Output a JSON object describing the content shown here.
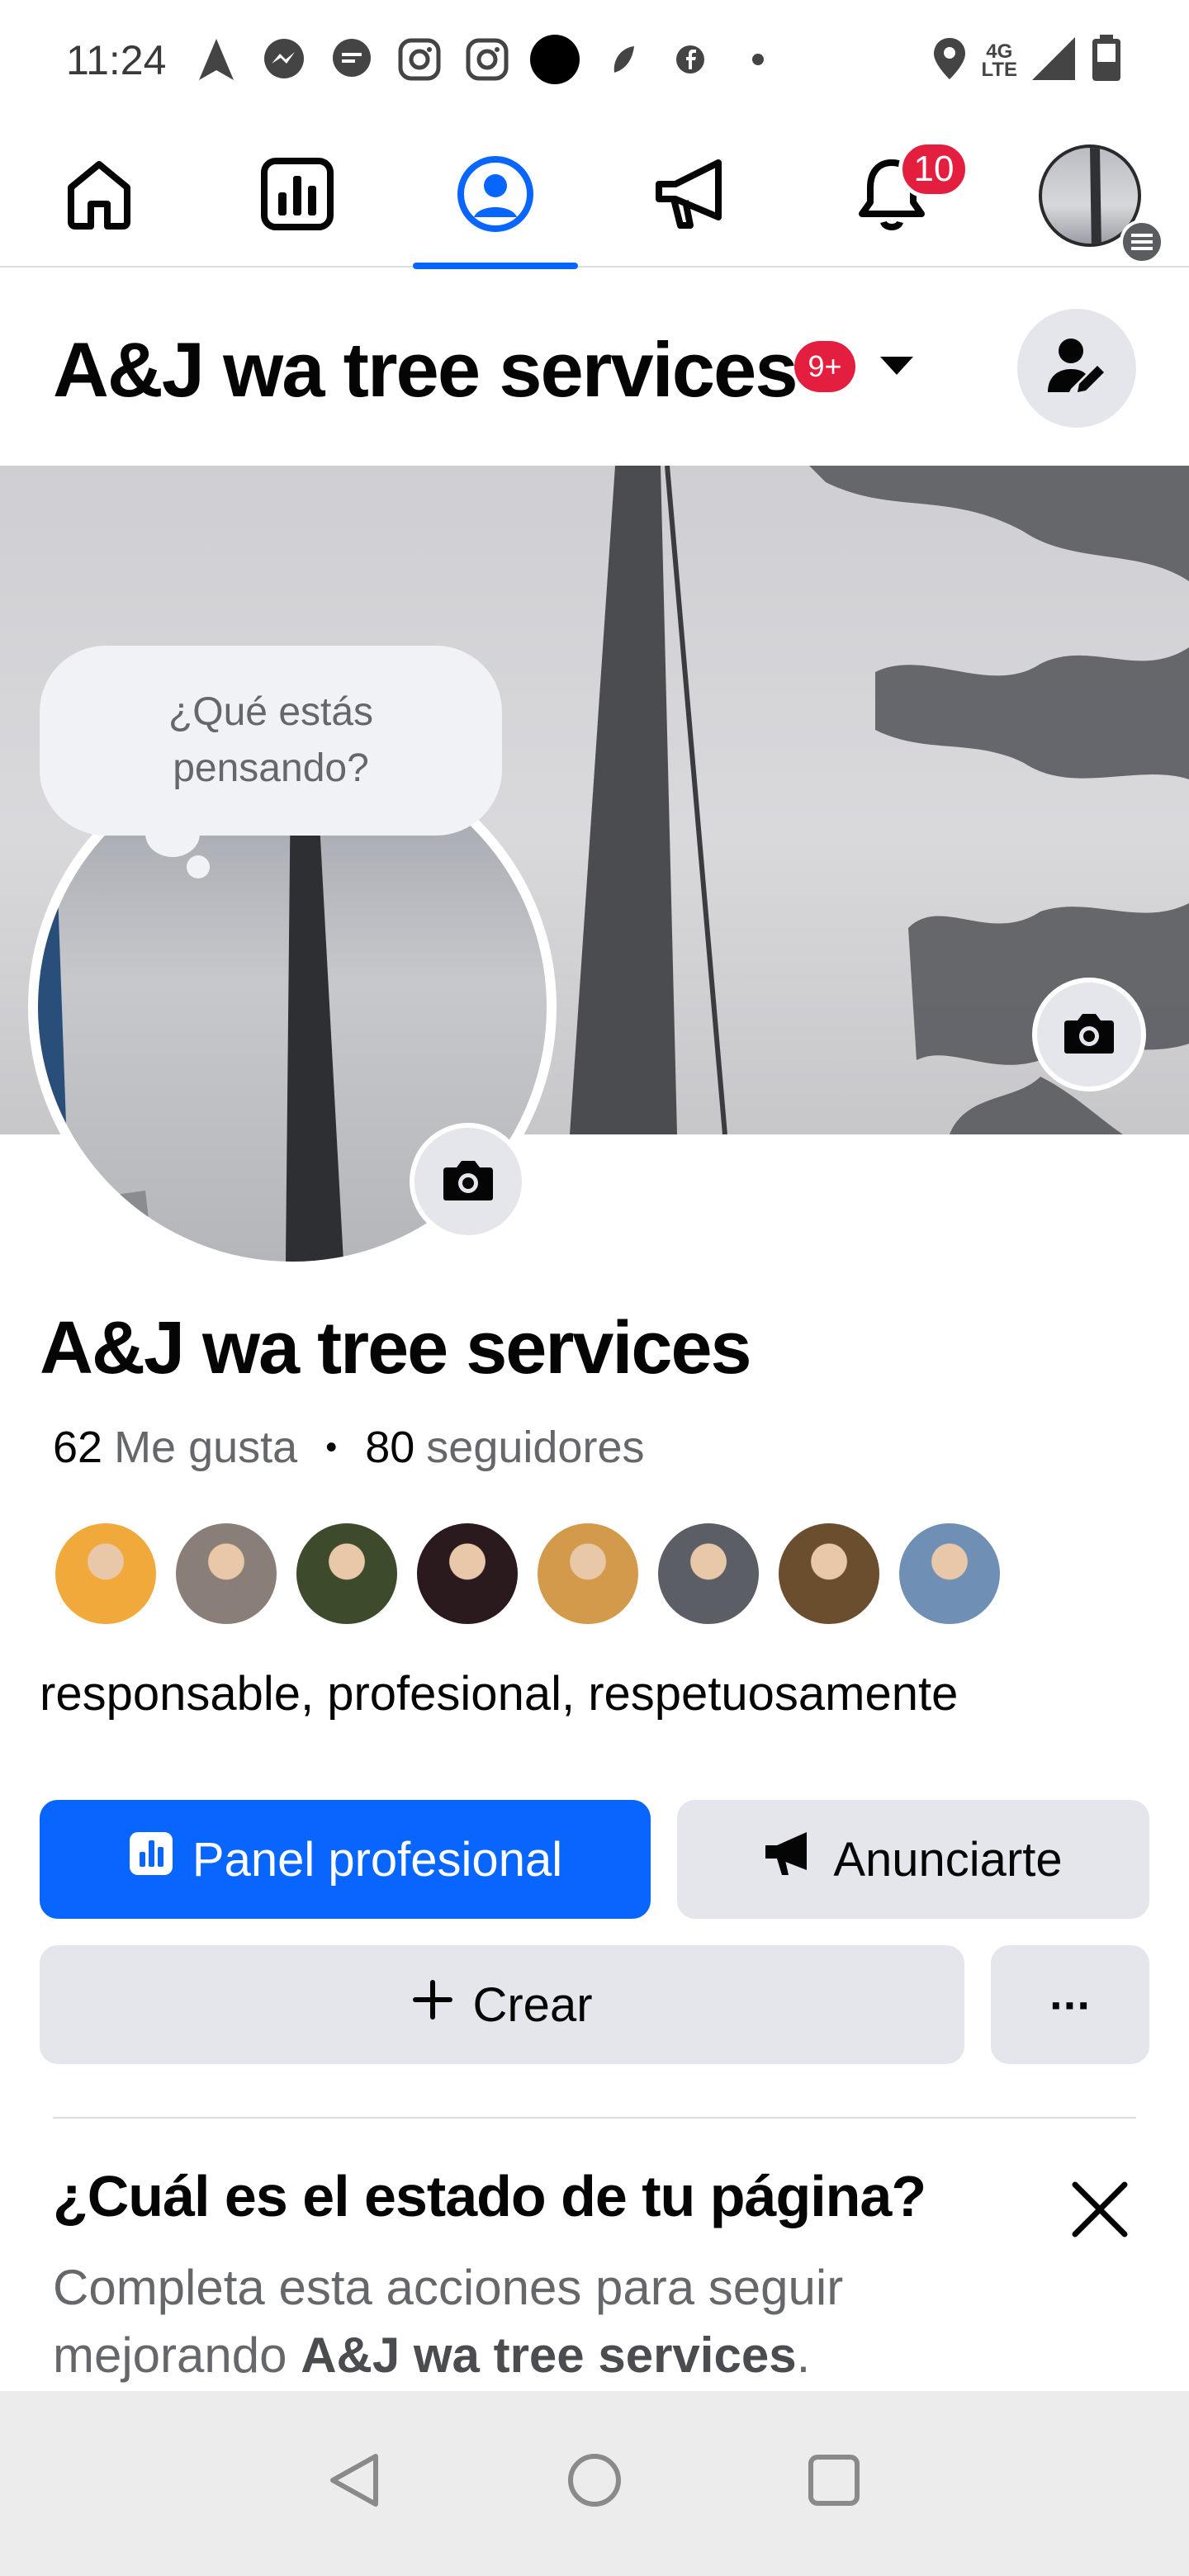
{
  "status_bar": {
    "time": "11:24",
    "left_icons": [
      "navigation-arrow-icon",
      "messenger-icon",
      "message-bubble-icon",
      "instagram-icon",
      "instagram-icon",
      "black-dot-icon",
      "leaf-icon",
      "facebook-icon",
      "small-dot-icon"
    ],
    "network_top": "4G",
    "network_bottom": "LTE",
    "right_icons": [
      "location-pin-icon",
      "signal-icon",
      "battery-icon"
    ]
  },
  "top_nav": {
    "items": [
      {
        "name": "home-icon",
        "active": false
      },
      {
        "name": "dashboard-icon",
        "active": false
      },
      {
        "name": "profile-icon",
        "active": true
      },
      {
        "name": "megaphone-icon",
        "active": false
      },
      {
        "name": "bell-icon",
        "active": false,
        "badge": "10"
      },
      {
        "name": "account-avatar",
        "active": false
      }
    ]
  },
  "header": {
    "page_name": "A&J wa tree services",
    "badge": "9+"
  },
  "profile": {
    "thought_prompt": "¿Qué estás pensando?",
    "name": "A&J wa tree services",
    "likes_count": "62",
    "likes_label": "Me gusta",
    "followers_count": "80",
    "followers_label": "seguidores",
    "follower_avatars": [
      "#f2a93b",
      "#8a7f78",
      "#3d4a2c",
      "#2a1a1e",
      "#d29a4a",
      "#5c5e66",
      "#6a4e2e",
      "#6f8fb5"
    ],
    "bio": "responsable, profesional, respetuosamente"
  },
  "actions": {
    "professional_dashboard": "Panel profesional",
    "advertise": "Anunciarte",
    "create": "Crear",
    "more": "···"
  },
  "page_status": {
    "title": "¿Cuál es el estado de tu página?",
    "desc_prefix": "Completa esta acciones para seguir mejorando ",
    "desc_page": "A&J wa tree services",
    "desc_suffix": "."
  },
  "colors": {
    "accent": "#0866ff",
    "badge": "#e41e3f",
    "secondary_button": "#e4e6eb"
  }
}
